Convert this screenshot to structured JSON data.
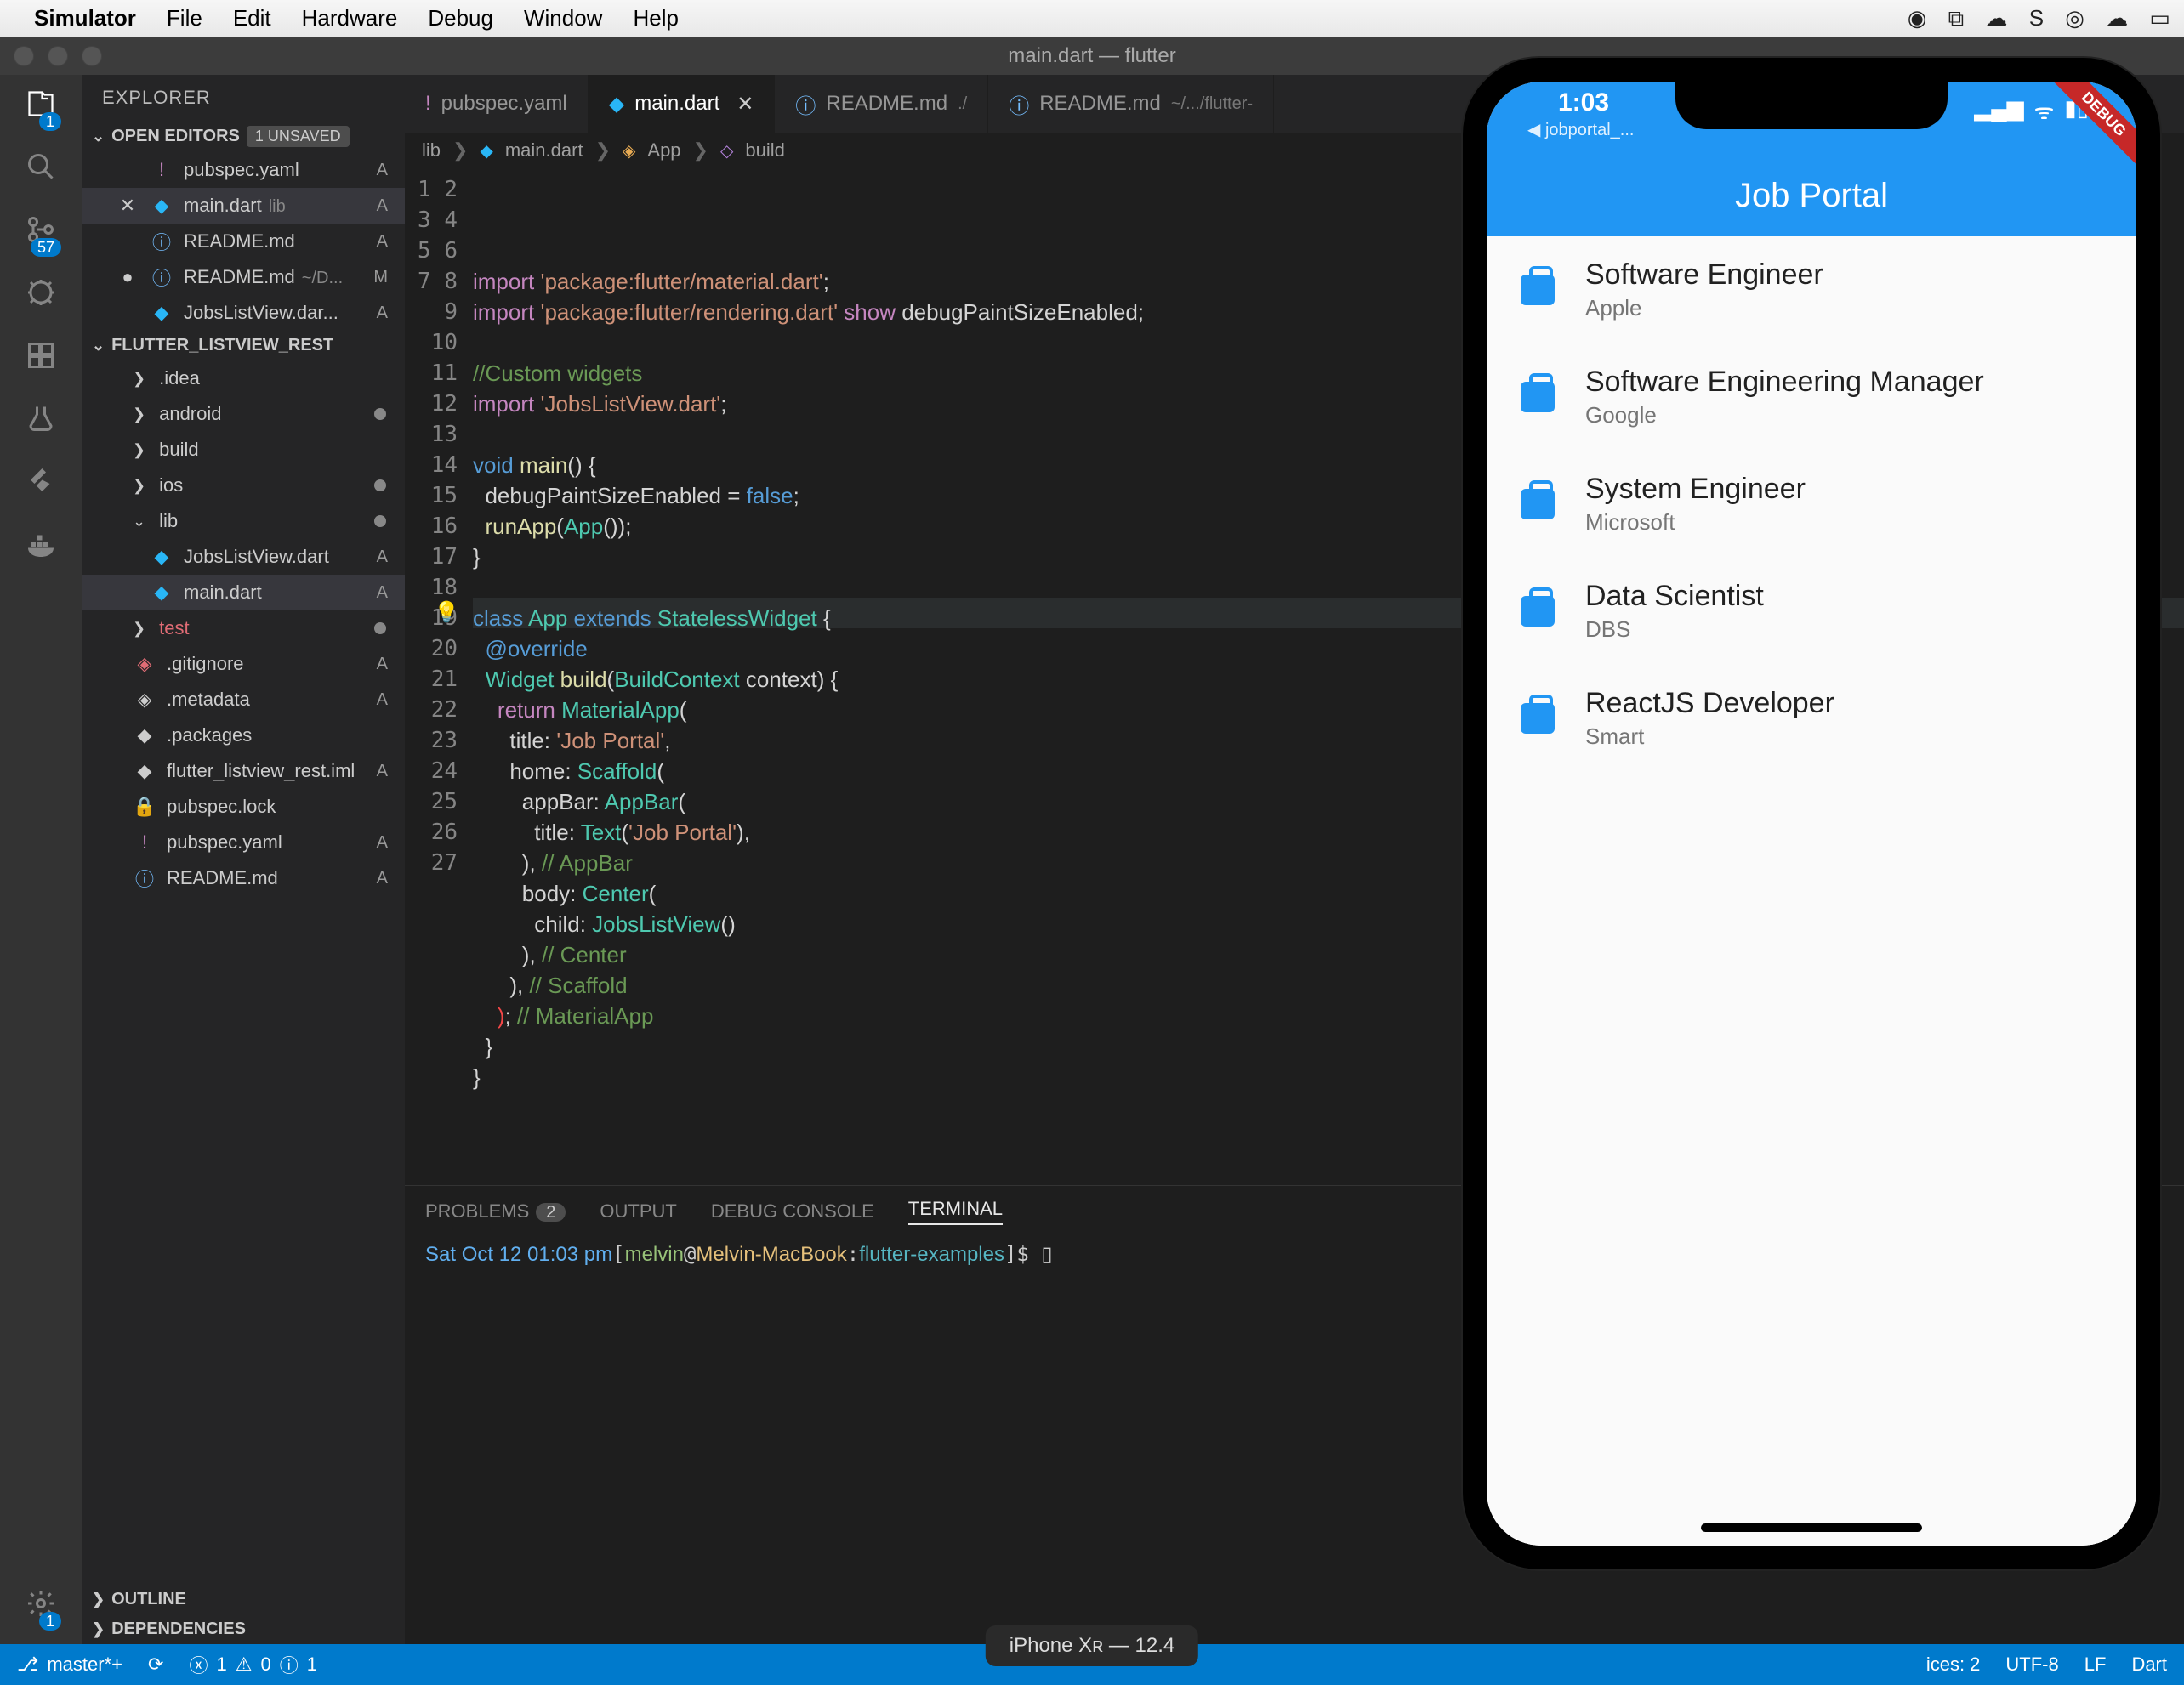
{
  "mac_menu": {
    "app": "Simulator",
    "items": [
      "File",
      "Edit",
      "Hardware",
      "Debug",
      "Window",
      "Help"
    ]
  },
  "titlebar": {
    "title": "main.dart — flutter"
  },
  "activitybar": {
    "explorer_badge": "1",
    "scm_badge": "57",
    "gear_badge": "1"
  },
  "sidebar": {
    "title": "EXPLORER",
    "open_editors_label": "OPEN EDITORS",
    "unsaved_tag": "1 UNSAVED",
    "open_editors": [
      {
        "icon": "!",
        "iconClass": "ic-yaml",
        "name": "pubspec.yaml",
        "status": "A",
        "close": ""
      },
      {
        "icon": "",
        "iconClass": "ic-dart",
        "name": "main.dart",
        "sub": "lib",
        "status": "A",
        "close": "✕",
        "sel": true
      },
      {
        "icon": "ⓘ",
        "iconClass": "ic-info",
        "name": "README.md",
        "status": "A",
        "close": ""
      },
      {
        "icon": "ⓘ",
        "iconClass": "ic-info",
        "name": "README.md",
        "sub": "~/D...",
        "status": "M",
        "close": "●"
      },
      {
        "icon": "",
        "iconClass": "ic-dart",
        "name": "JobsListView.dar...",
        "status": "A",
        "close": ""
      }
    ],
    "project_label": "FLUTTER_LISTVIEW_REST",
    "tree": [
      {
        "chev": "❯",
        "name": ".idea",
        "status": ""
      },
      {
        "chev": "❯",
        "name": "android",
        "status": "●"
      },
      {
        "chev": "❯",
        "name": "build",
        "status": ""
      },
      {
        "chev": "❯",
        "name": "ios",
        "status": "●"
      },
      {
        "chev": "⌄",
        "name": "lib",
        "status": "●"
      },
      {
        "chev": "",
        "name": "JobsListView.dart",
        "status": "A",
        "icon": "",
        "iconClass": "ic-dart",
        "indent": true
      },
      {
        "chev": "",
        "name": "main.dart",
        "status": "A",
        "icon": "",
        "iconClass": "ic-dart",
        "indent": true,
        "sel": true
      },
      {
        "chev": "❯",
        "name": "test",
        "status": "●",
        "red": true
      },
      {
        "chev": "",
        "name": ".gitignore",
        "status": "A",
        "icon": "◈",
        "iconClass": "ic-git"
      },
      {
        "chev": "",
        "name": ".metadata",
        "status": "A",
        "icon": "◈"
      },
      {
        "chev": "",
        "name": ".packages",
        "status": ""
      },
      {
        "chev": "",
        "name": "flutter_listview_rest.iml",
        "status": "A"
      },
      {
        "chev": "",
        "name": "pubspec.lock",
        "status": "",
        "icon": "🔒"
      },
      {
        "chev": "",
        "name": "pubspec.yaml",
        "status": "A",
        "icon": "!",
        "iconClass": "ic-yaml"
      },
      {
        "chev": "",
        "name": "README.md",
        "status": "A",
        "icon": "ⓘ",
        "iconClass": "ic-info"
      }
    ],
    "outline_label": "OUTLINE",
    "dependencies_label": "DEPENDENCIES"
  },
  "tabs": [
    {
      "icon": "!",
      "iconClass": "ic-yaml",
      "label": "pubspec.yaml"
    },
    {
      "icon": "",
      "iconClass": "ic-dart",
      "label": "main.dart",
      "active": true,
      "close": "✕"
    },
    {
      "icon": "ⓘ",
      "iconClass": "ic-info",
      "label": "README.md",
      "sub": "./"
    },
    {
      "icon": "ⓘ",
      "iconClass": "ic-info",
      "label": "README.md",
      "sub": "~/.../flutter-"
    }
  ],
  "breadcrumb": [
    "lib",
    "main.dart",
    "App",
    "build"
  ],
  "code_lines": 27,
  "panel": {
    "problems": "PROBLEMS",
    "problems_count": "2",
    "output": "OUTPUT",
    "debug": "DEBUG CONSOLE",
    "terminal": "TERMINAL",
    "prompt_date": "Sat Oct 12 01:03 pm",
    "prompt_user": "melvin",
    "prompt_host": "Melvin-MacBook",
    "prompt_path": "flutter-examples",
    "cursor": "▯"
  },
  "statusbar": {
    "branch": "master*+",
    "errors": "1",
    "warnings": "0",
    "info": "1",
    "device": "iPhone Xʀ — 12.4",
    "spaces": "ices: 2",
    "enc": "UTF-8",
    "eol": "LF",
    "lang": "Dart"
  },
  "simulator": {
    "time": "1:03",
    "back": "◀ jobportal_...",
    "appbar": "Job Portal",
    "debug": "DEBUG",
    "caption": "iPhone Xʀ — 12.4",
    "jobs": [
      {
        "title": "Software Engineer",
        "company": "Apple"
      },
      {
        "title": "Software Engineering Manager",
        "company": "Google"
      },
      {
        "title": "System Engineer",
        "company": "Microsoft"
      },
      {
        "title": "Data Scientist",
        "company": "DBS"
      },
      {
        "title": "ReactJS Developer",
        "company": "Smart"
      }
    ]
  }
}
